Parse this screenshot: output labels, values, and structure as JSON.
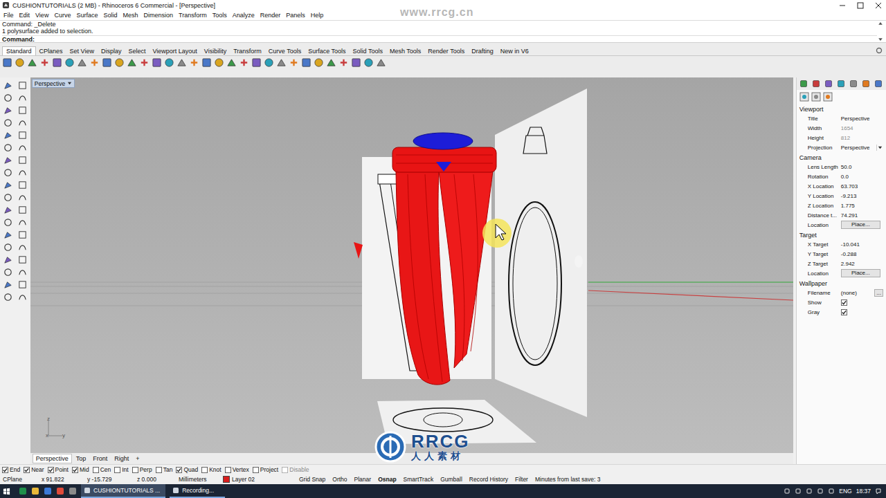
{
  "window": {
    "title": "CUSHIONTUTORIALS (2 MB) - Rhinoceros 6 Commercial - [Perspective]"
  },
  "watermark": {
    "url": "www.rrcg.cn",
    "logo": "RRCG",
    "logo_sub": "人人素材"
  },
  "menu": [
    "File",
    "Edit",
    "View",
    "Curve",
    "Surface",
    "Solid",
    "Mesh",
    "Dimension",
    "Transform",
    "Tools",
    "Analyze",
    "Render",
    "Panels",
    "Help"
  ],
  "command": {
    "history": [
      "Command: _Delete",
      "1 polysurface added to selection."
    ],
    "prompt": "Command:"
  },
  "toolbar_tabs": [
    {
      "label": "Standard",
      "selected": true
    },
    {
      "label": "CPlanes",
      "selected": false
    },
    {
      "label": "Set View",
      "selected": false
    },
    {
      "label": "Display",
      "selected": false
    },
    {
      "label": "Select",
      "selected": false
    },
    {
      "label": "Viewport Layout",
      "selected": false
    },
    {
      "label": "Visibility",
      "selected": false
    },
    {
      "label": "Transform",
      "selected": false
    },
    {
      "label": "Curve Tools",
      "selected": false
    },
    {
      "label": "Surface Tools",
      "selected": false
    },
    {
      "label": "Solid Tools",
      "selected": false
    },
    {
      "label": "Mesh Tools",
      "selected": false
    },
    {
      "label": "Render Tools",
      "selected": false
    },
    {
      "label": "Drafting",
      "selected": false
    },
    {
      "label": "New in V6",
      "selected": false
    }
  ],
  "viewport": {
    "label": "Perspective",
    "axes": [
      "z",
      "x",
      "y"
    ]
  },
  "viewport_tabs": [
    {
      "label": "Perspective",
      "selected": true
    },
    {
      "label": "Top",
      "selected": false
    },
    {
      "label": "Front",
      "selected": false
    },
    {
      "label": "Right",
      "selected": false
    }
  ],
  "add_tab": "+",
  "properties": [
    {
      "title": "Viewport",
      "rows": [
        {
          "label": "Title",
          "value": "Perspective",
          "kind": "text"
        },
        {
          "label": "Width",
          "value": "1654",
          "kind": "disabled"
        },
        {
          "label": "Height",
          "value": "812",
          "kind": "disabled"
        },
        {
          "label": "Projection",
          "value": "Perspective",
          "kind": "dropdown"
        }
      ]
    },
    {
      "title": "Camera",
      "rows": [
        {
          "label": "Lens Length",
          "value": "50.0",
          "kind": "text"
        },
        {
          "label": "Rotation",
          "value": "0.0",
          "kind": "text"
        },
        {
          "label": "X Location",
          "value": "63.703",
          "kind": "text"
        },
        {
          "label": "Y Location",
          "value": "-9.213",
          "kind": "text"
        },
        {
          "label": "Z Location",
          "value": "1.775",
          "kind": "text"
        },
        {
          "label": "Distance t...",
          "value": "74.291",
          "kind": "text"
        },
        {
          "label": "Location",
          "value": "Place...",
          "kind": "button"
        }
      ]
    },
    {
      "title": "Target",
      "rows": [
        {
          "label": "X Target",
          "value": "-10.041",
          "kind": "text"
        },
        {
          "label": "Y Target",
          "value": "-0.288",
          "kind": "text"
        },
        {
          "label": "Z Target",
          "value": "2.942",
          "kind": "text"
        },
        {
          "label": "Location",
          "value": "Place...",
          "kind": "button"
        }
      ]
    },
    {
      "title": "Wallpaper",
      "rows": [
        {
          "label": "Filename",
          "value": "(none)",
          "kind": "browse",
          "button": "..."
        },
        {
          "label": "Show",
          "checked": true,
          "kind": "check"
        },
        {
          "label": "Gray",
          "checked": true,
          "kind": "check"
        }
      ]
    }
  ],
  "osnaps": [
    {
      "label": "End",
      "checked": true,
      "disabled": false
    },
    {
      "label": "Near",
      "checked": true,
      "disabled": false
    },
    {
      "label": "Point",
      "checked": true,
      "disabled": false
    },
    {
      "label": "Mid",
      "checked": true,
      "disabled": false
    },
    {
      "label": "Cen",
      "checked": false,
      "disabled": false
    },
    {
      "label": "Int",
      "checked": false,
      "disabled": false
    },
    {
      "label": "Perp",
      "checked": false,
      "disabled": false
    },
    {
      "label": "Tan",
      "checked": false,
      "disabled": false
    },
    {
      "label": "Quad",
      "checked": true,
      "disabled": false
    },
    {
      "label": "Knot",
      "checked": false,
      "disabled": false
    },
    {
      "label": "Vertex",
      "checked": false,
      "disabled": false
    },
    {
      "label": "Project",
      "checked": false,
      "disabled": false
    },
    {
      "label": "Disable",
      "checked": false,
      "disabled": true
    }
  ],
  "status_bar": {
    "cplane": "CPlane",
    "x": "x 91.822",
    "y": "y -15.729",
    "z": "z 0.000",
    "units": "Millimeters",
    "layer": {
      "name": "Layer 02",
      "color": "#d81e1e"
    },
    "toggles": [
      {
        "label": "Grid Snap",
        "on": false
      },
      {
        "label": "Ortho",
        "on": false
      },
      {
        "label": "Planar",
        "on": false
      },
      {
        "label": "Osnap",
        "on": true
      },
      {
        "label": "SmartTrack",
        "on": false
      },
      {
        "label": "Gumball",
        "on": false
      },
      {
        "label": "Record History",
        "on": false
      },
      {
        "label": "Filter",
        "on": false
      }
    ],
    "info": "Minutes from last save: 3"
  },
  "taskbar": {
    "apps": [
      {
        "label": "CUSHIONTUTORIALS ...",
        "selected": true
      },
      {
        "label": "Recording...",
        "selected": false
      }
    ],
    "lang": "ENG",
    "time": "18:37"
  }
}
